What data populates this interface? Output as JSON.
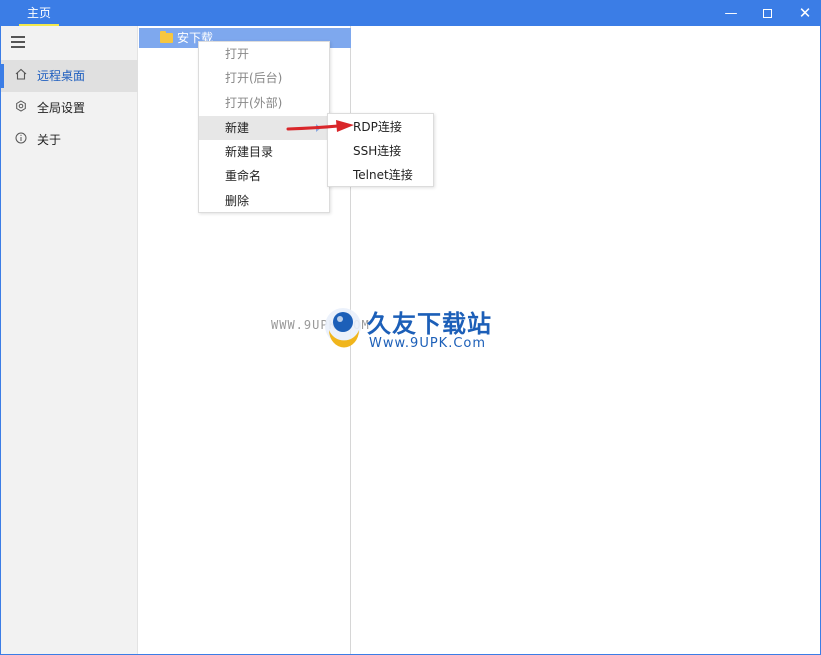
{
  "titlebar": {
    "tab_label": "主页",
    "minimize_glyph": "—",
    "close_glyph": "✕"
  },
  "sidebar": {
    "menu_icon": "hamburger-icon",
    "items": [
      {
        "label": "远程桌面",
        "icon": "home-icon",
        "active": true
      },
      {
        "label": "全局设置",
        "icon": "gear-icon",
        "active": false
      },
      {
        "label": "关于",
        "icon": "info-icon",
        "active": false
      }
    ]
  },
  "tree": {
    "selected_folder": "安下载",
    "folder_icon": "folder-icon"
  },
  "context_menu": {
    "items": [
      {
        "label": "打开",
        "disabled": true
      },
      {
        "label": "打开(后台)",
        "disabled": true
      },
      {
        "label": "打开(外部)",
        "disabled": true
      },
      {
        "label": "新建",
        "disabled": false,
        "has_submenu": true
      },
      {
        "label": "新建目录",
        "disabled": false
      },
      {
        "label": "重命名",
        "disabled": false
      },
      {
        "label": "删除",
        "disabled": false
      }
    ]
  },
  "submenu": {
    "items": [
      {
        "label": "RDP连接"
      },
      {
        "label": "SSH连接"
      },
      {
        "label": "Telnet连接"
      }
    ]
  },
  "watermark": {
    "url_text": "WWW.9UPK.COM",
    "name_cn": "久友下载站",
    "name_en": "Www.9UPK.Com"
  },
  "colors": {
    "accent": "#3b7de6",
    "tab_underline": "#f2e94e",
    "selected_row": "#7ea8ee",
    "arrow": "#d9262a"
  }
}
